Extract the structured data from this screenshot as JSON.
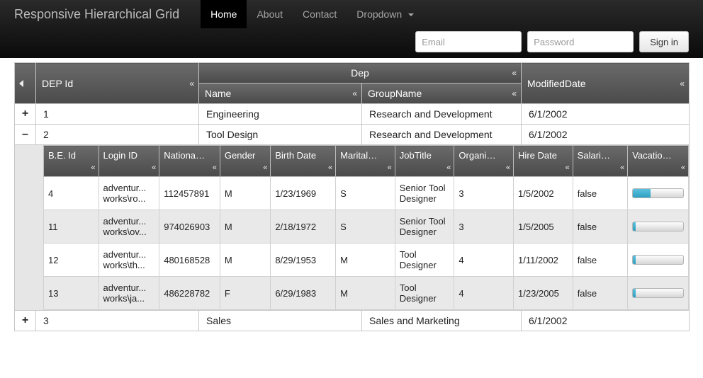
{
  "nav": {
    "brand": "Responsive Hierarchical Grid",
    "items": [
      "Home",
      "About",
      "Contact",
      "Dropdown"
    ],
    "email_ph": "Email",
    "password_ph": "Password",
    "signin": "Sign in"
  },
  "parent_headers": {
    "dep_id": "DEP Id",
    "dep_group": "Dep",
    "name": "Name",
    "group_name": "GroupName",
    "modified": "ModifiedDate"
  },
  "parent_rows": [
    {
      "exp": "+",
      "id": "1",
      "name": "Engineering",
      "group": "Research and Development",
      "modified": "6/1/2002"
    },
    {
      "exp": "–",
      "id": "2",
      "name": "Tool Design",
      "group": "Research and Development",
      "modified": "6/1/2002"
    },
    {
      "exp": "+",
      "id": "3",
      "name": "Sales",
      "group": "Sales and Marketing",
      "modified": "6/1/2002"
    }
  ],
  "child_headers": {
    "be_id": "B.E. Id",
    "login": "Login ID",
    "nat": "National ID Num",
    "gender": "Gender",
    "birth": "Birth Date",
    "marital": "MaritalSt...",
    "job": "JobTitle",
    "org": "Organiza... Level",
    "hire": "Hire Date",
    "sal": "Salaried Flag",
    "vac": "Vacation..."
  },
  "child_rows": [
    {
      "id": "4",
      "login": "adventur... works\\ro...",
      "nat": "112457891",
      "gender": "M",
      "birth": "1/23/1969",
      "marital": "S",
      "job": "Senior Tool Designer",
      "org": "3",
      "hire": "1/5/2002",
      "sal": "false",
      "vac": 35
    },
    {
      "id": "11",
      "login": "adventur... works\\ov...",
      "nat": "974026903",
      "gender": "M",
      "birth": "2/18/1972",
      "marital": "S",
      "job": "Senior Tool Designer",
      "org": "3",
      "hire": "1/5/2005",
      "sal": "false",
      "vac": 6
    },
    {
      "id": "12",
      "login": "adventur... works\\th...",
      "nat": "480168528",
      "gender": "M",
      "birth": "8/29/1953",
      "marital": "M",
      "job": "Tool Designer",
      "org": "4",
      "hire": "1/11/2002",
      "sal": "false",
      "vac": 6
    },
    {
      "id": "13",
      "login": "adventur... works\\ja...",
      "nat": "486228782",
      "gender": "F",
      "birth": "6/29/1983",
      "marital": "M",
      "job": "Tool Designer",
      "org": "4",
      "hire": "1/23/2005",
      "sal": "false",
      "vac": 6
    }
  ]
}
